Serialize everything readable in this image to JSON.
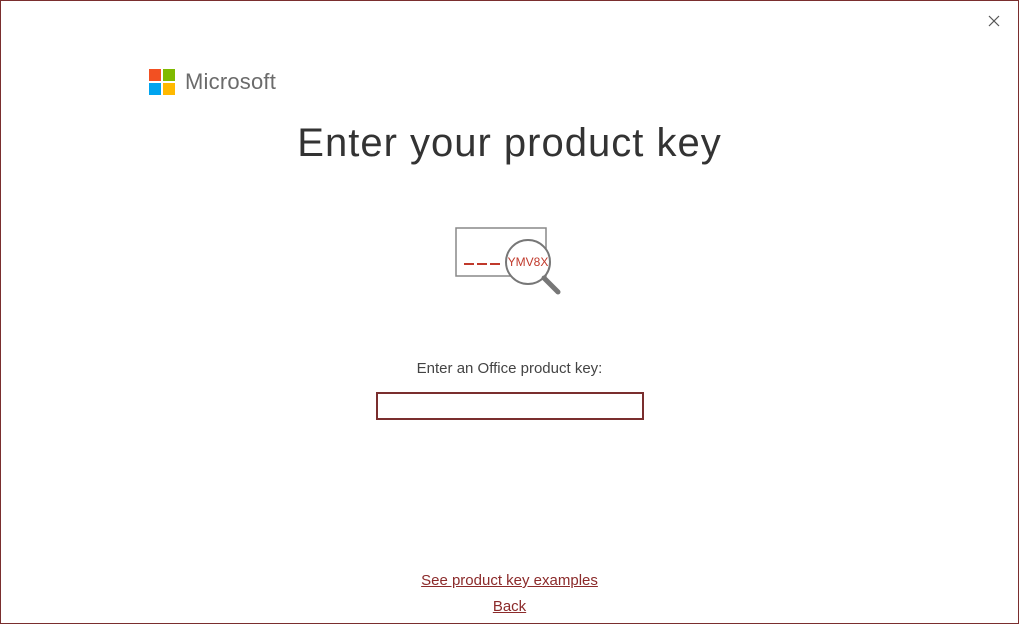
{
  "brand": "Microsoft",
  "title": "Enter your product key",
  "illustration": {
    "sample_key_text": "YMV8X"
  },
  "form": {
    "label": "Enter an Office product key:",
    "value": ""
  },
  "links": {
    "examples": "See product key examples",
    "back": "Back"
  },
  "colors": {
    "accent": "#7a2e2e",
    "link": "#8b2a2a"
  }
}
